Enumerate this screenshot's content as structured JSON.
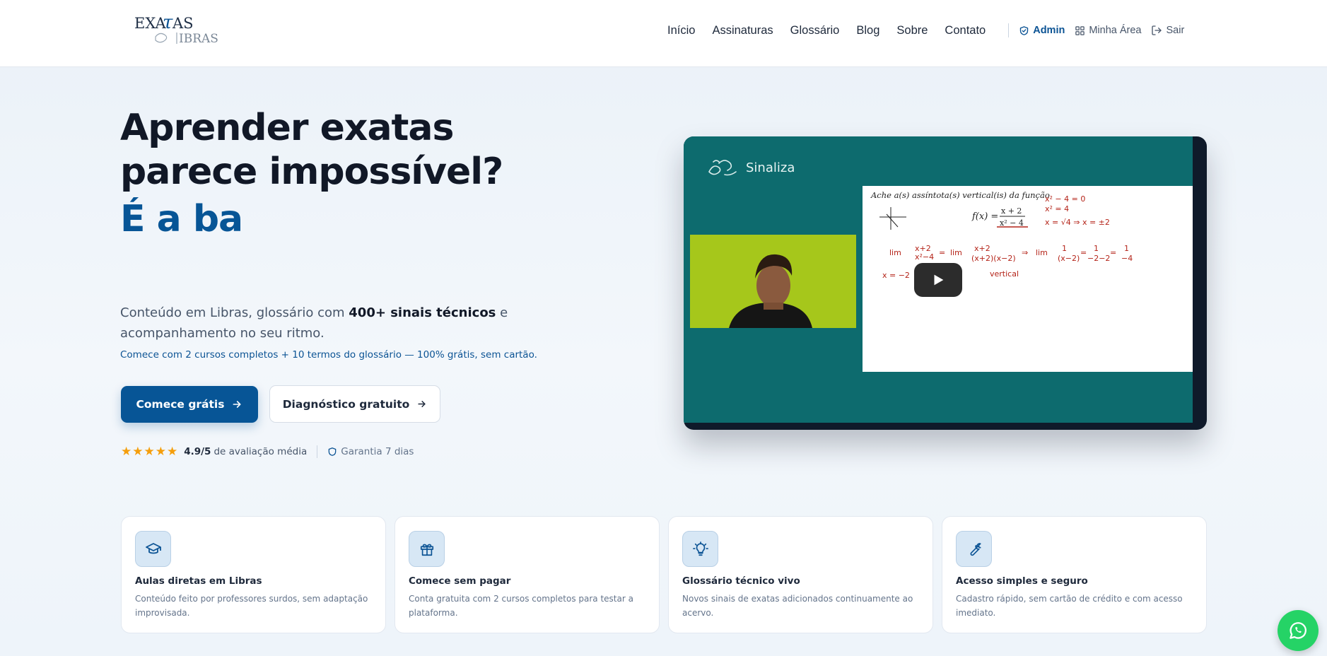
{
  "header": {
    "logo_alt": "Exatas em Libras",
    "nav": [
      {
        "label": "Início"
      },
      {
        "label": "Assinaturas"
      },
      {
        "label": "Glossário"
      },
      {
        "label": "Blog"
      },
      {
        "label": "Sobre"
      },
      {
        "label": "Contato"
      }
    ],
    "admin_label": "Admin",
    "area_label": "Minha Área",
    "logout_label": "Sair"
  },
  "hero": {
    "title_line1": "Aprender exatas",
    "title_line2": "parece impossível?",
    "accent": "É a ba",
    "desc_pre": "Conteúdo em Libras, glossário com ",
    "desc_bold": "400+ sinais técnicos",
    "desc_post": " e acompanhamento no seu ritmo.",
    "note": "Comece com 2 cursos completos + 10 termos do glossário — 100% grátis, sem cartão.",
    "cta_primary": "Comece grátis",
    "cta_secondary": "Diagnóstico gratuito",
    "stars": "★★★★★",
    "rating_score": "4.9/5",
    "rating_text": "de avaliação média",
    "guarantee": "Garantia 7 dias"
  },
  "video": {
    "brand": "Sinaliza",
    "board_title": "Ache a(s) assíntota(s) vertical(is) da função"
  },
  "features": [
    {
      "icon": "graduation-cap-icon",
      "title": "Aulas diretas em Libras",
      "desc": "Conteúdo feito por professores surdos, sem adaptação improvisada."
    },
    {
      "icon": "gift-icon",
      "title": "Comece sem pagar",
      "desc": "Conta gratuita com 2 cursos completos para testar a plataforma."
    },
    {
      "icon": "lightbulb-icon",
      "title": "Glossário técnico vivo",
      "desc": "Novos sinais de exatas adicionados continuamente ao acervo."
    },
    {
      "icon": "wrench-icon",
      "title": "Acesso simples e seguro",
      "desc": "Cadastro rápido, sem cartão de crédito e com acesso imediato."
    }
  ],
  "colors": {
    "primary": "#075596",
    "accent_text": "#0b5394",
    "star": "#f59e0b",
    "whatsapp": "#25d366"
  }
}
